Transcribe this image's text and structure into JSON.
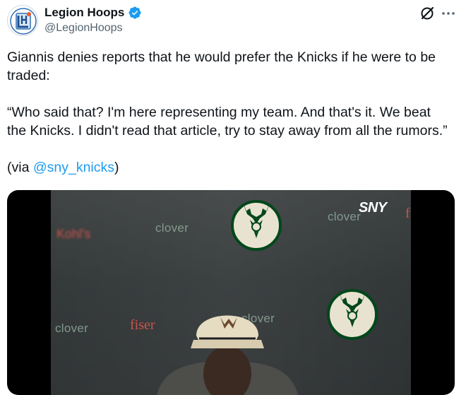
{
  "author": {
    "name": "Legion Hoops",
    "handle": "@LegionHoops",
    "avatar_icon": "legion-hoops-logo",
    "verified_icon": "verified-badge-icon",
    "verified_color": "#1d9bf0"
  },
  "actions": {
    "grok_icon": "grok-icon",
    "more_icon": "more-options-icon"
  },
  "tweet": {
    "line1": "Giannis denies reports that he would prefer the Knicks if he were to be traded:",
    "quote": "“Who said that? I'm here representing my team. And that's it. We beat the Knicks. I didn't read that article, try to stay away from all the rumors.”",
    "via_prefix": "(via ",
    "via_mention": "@sny_knicks",
    "via_suffix": ")"
  },
  "media": {
    "type": "video",
    "sponsor_texts": [
      "clover",
      "clover",
      "clover",
      "clover"
    ],
    "sponsor_red_1": "fiser",
    "sponsor_red_2": "f",
    "blurred_sponsor": "Kohl's",
    "network_logo": "SNY",
    "team_logo_icon": "milwaukee-bucks-logo",
    "cap_logo_icon": "bucks-deer-cap-logo"
  },
  "colors": {
    "link": "#1d9bf0",
    "text": "#0f1419",
    "secondary": "#536471"
  }
}
